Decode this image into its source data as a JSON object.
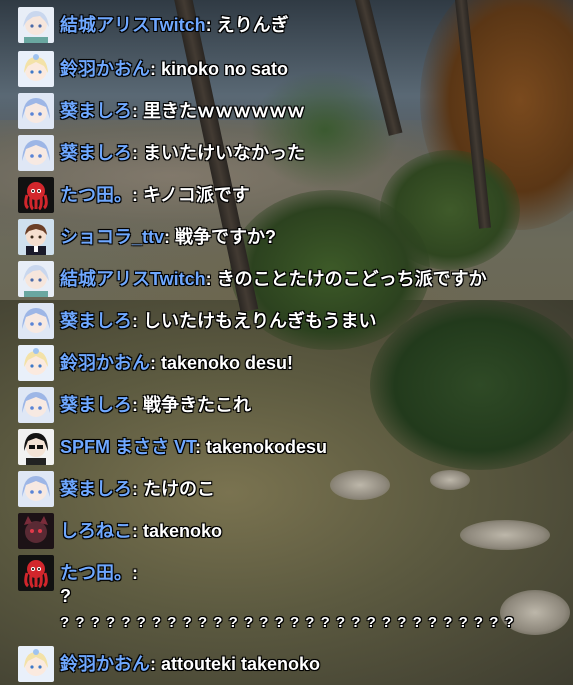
{
  "messages": [
    {
      "user": "結城アリスTwitch",
      "text": "えりんぎ",
      "avatar": "alice-avatar"
    },
    {
      "user": "鈴羽かおん",
      "text": "kinoko no sato",
      "avatar": "kaon-avatar"
    },
    {
      "user": "葵ましろ",
      "text": "里きたｗｗｗｗｗｗ",
      "avatar": "mashiro-avatar"
    },
    {
      "user": "葵ましろ",
      "text": "まいたけいなかった",
      "avatar": "mashiro-avatar"
    },
    {
      "user": "たつ田。",
      "text": "キノコ派です",
      "avatar": "tatsuta-avatar"
    },
    {
      "user": "ショコラ_ttv",
      "text": "戦争ですか?",
      "avatar": "chocola-avatar"
    },
    {
      "user": "結城アリスTwitch",
      "text": "きのことたけのこどっち派ですか",
      "avatar": "alice-avatar"
    },
    {
      "user": "葵ましろ",
      "text": "しいたけもえりんぎもうまい",
      "avatar": "mashiro-avatar"
    },
    {
      "user": "鈴羽かおん",
      "text": "takenoko desu!",
      "avatar": "kaon-avatar"
    },
    {
      "user": "葵ましろ",
      "text": "戦争きたこれ",
      "avatar": "mashiro-avatar"
    },
    {
      "user": "SPFM まささ VT",
      "text": "takenokodesu",
      "avatar": "masasa-avatar"
    },
    {
      "user": "葵ましろ",
      "text": "たけのこ",
      "avatar": "mashiro-avatar"
    },
    {
      "user": "しろねこ",
      "text": "takenoko",
      "avatar": "shironeko-avatar"
    },
    {
      "user": "たつ田。",
      "text": "",
      "line2": "?",
      "line3": "? ? ? ? ? ? ? ? ? ? ? ? ? ? ? ? ? ? ? ? ? ? ? ? ? ? ? ? ? ?",
      "avatar": "tatsuta-avatar"
    },
    {
      "user": "鈴羽かおん",
      "text": "attouteki takenoko",
      "avatar": "kaon-avatar"
    }
  ],
  "colors": {
    "username": "#6fa8ff",
    "message": "#ffffff"
  }
}
